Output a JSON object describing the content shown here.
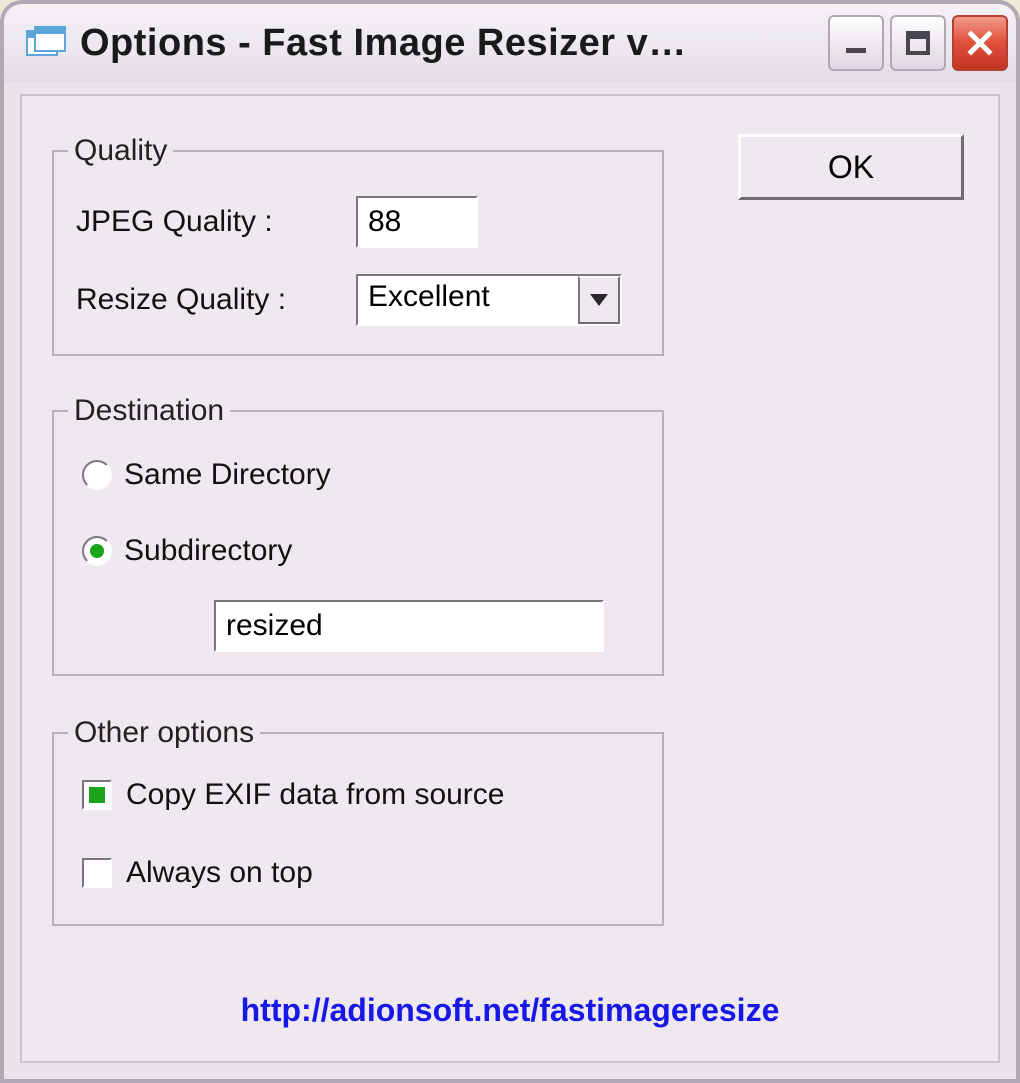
{
  "window": {
    "title": "Options - Fast Image Resizer v…",
    "icon": "app-window-icon"
  },
  "buttons": {
    "ok": "OK"
  },
  "quality": {
    "legend": "Quality",
    "jpeg_label": "JPEG Quality :",
    "jpeg_value": "88",
    "resize_label": "Resize Quality :",
    "resize_selected": "Excellent"
  },
  "destination": {
    "legend": "Destination",
    "same_label": "Same Directory",
    "same_checked": false,
    "sub_label": "Subdirectory",
    "sub_checked": true,
    "sub_value": "resized"
  },
  "other": {
    "legend": "Other options",
    "exif_label": "Copy EXIF data from source",
    "exif_checked": true,
    "ontop_label": "Always on top",
    "ontop_checked": false
  },
  "link": {
    "text": "http://adionsoft.net/fastimageresize"
  }
}
